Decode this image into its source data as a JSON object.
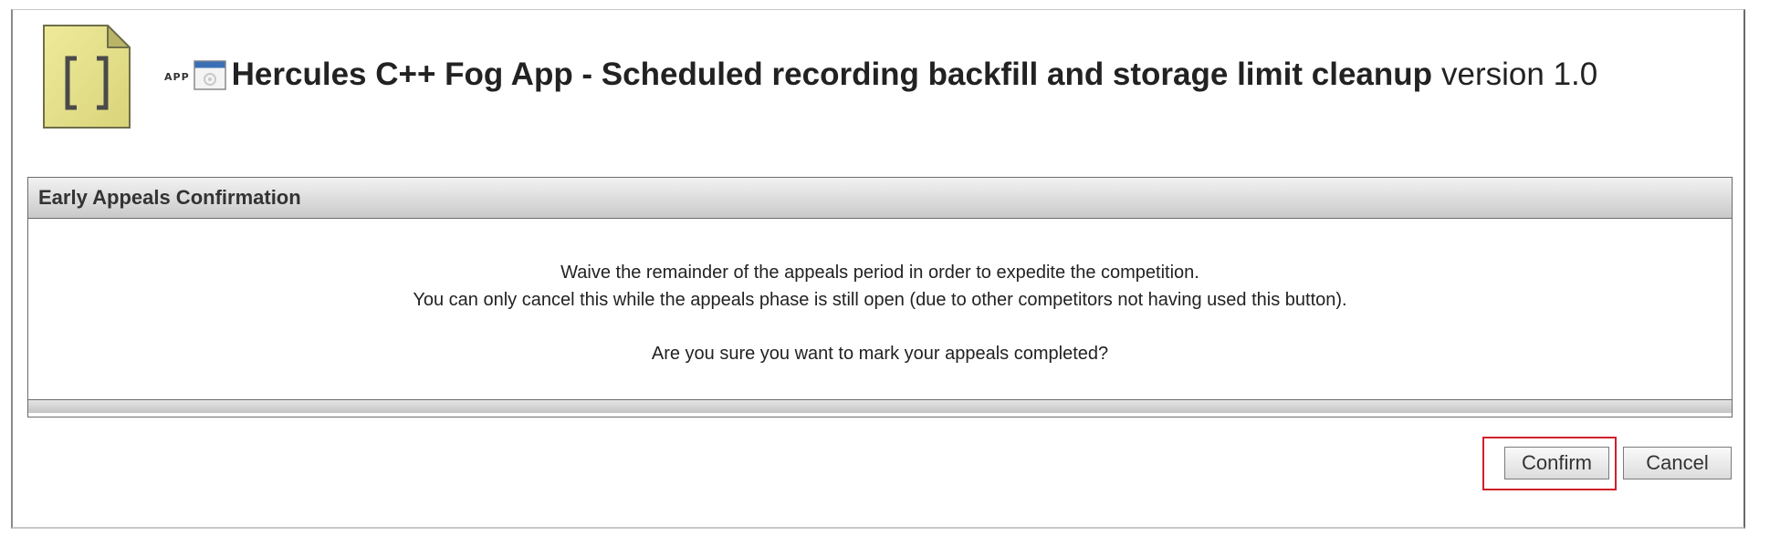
{
  "header": {
    "app_tag": "APP",
    "title": "Hercules C++ Fog App - Scheduled recording backfill and storage limit cleanup",
    "version": "version 1.0"
  },
  "panel": {
    "title": "Early Appeals Confirmation",
    "lines": [
      "Waive the remainder of the appeals period in order to expedite the competition.",
      "You can only cancel this while the appeals phase is still open (due to other competitors not having used this button).",
      "Are you sure you want to mark your appeals completed?"
    ]
  },
  "actions": {
    "confirm_label": "Confirm",
    "cancel_label": "Cancel"
  },
  "icons": {
    "document": "code-document-icon",
    "window": "app-window-icon"
  },
  "colors": {
    "doc_icon_fill": "#e6e28c",
    "highlight_border": "#d01f2b"
  }
}
